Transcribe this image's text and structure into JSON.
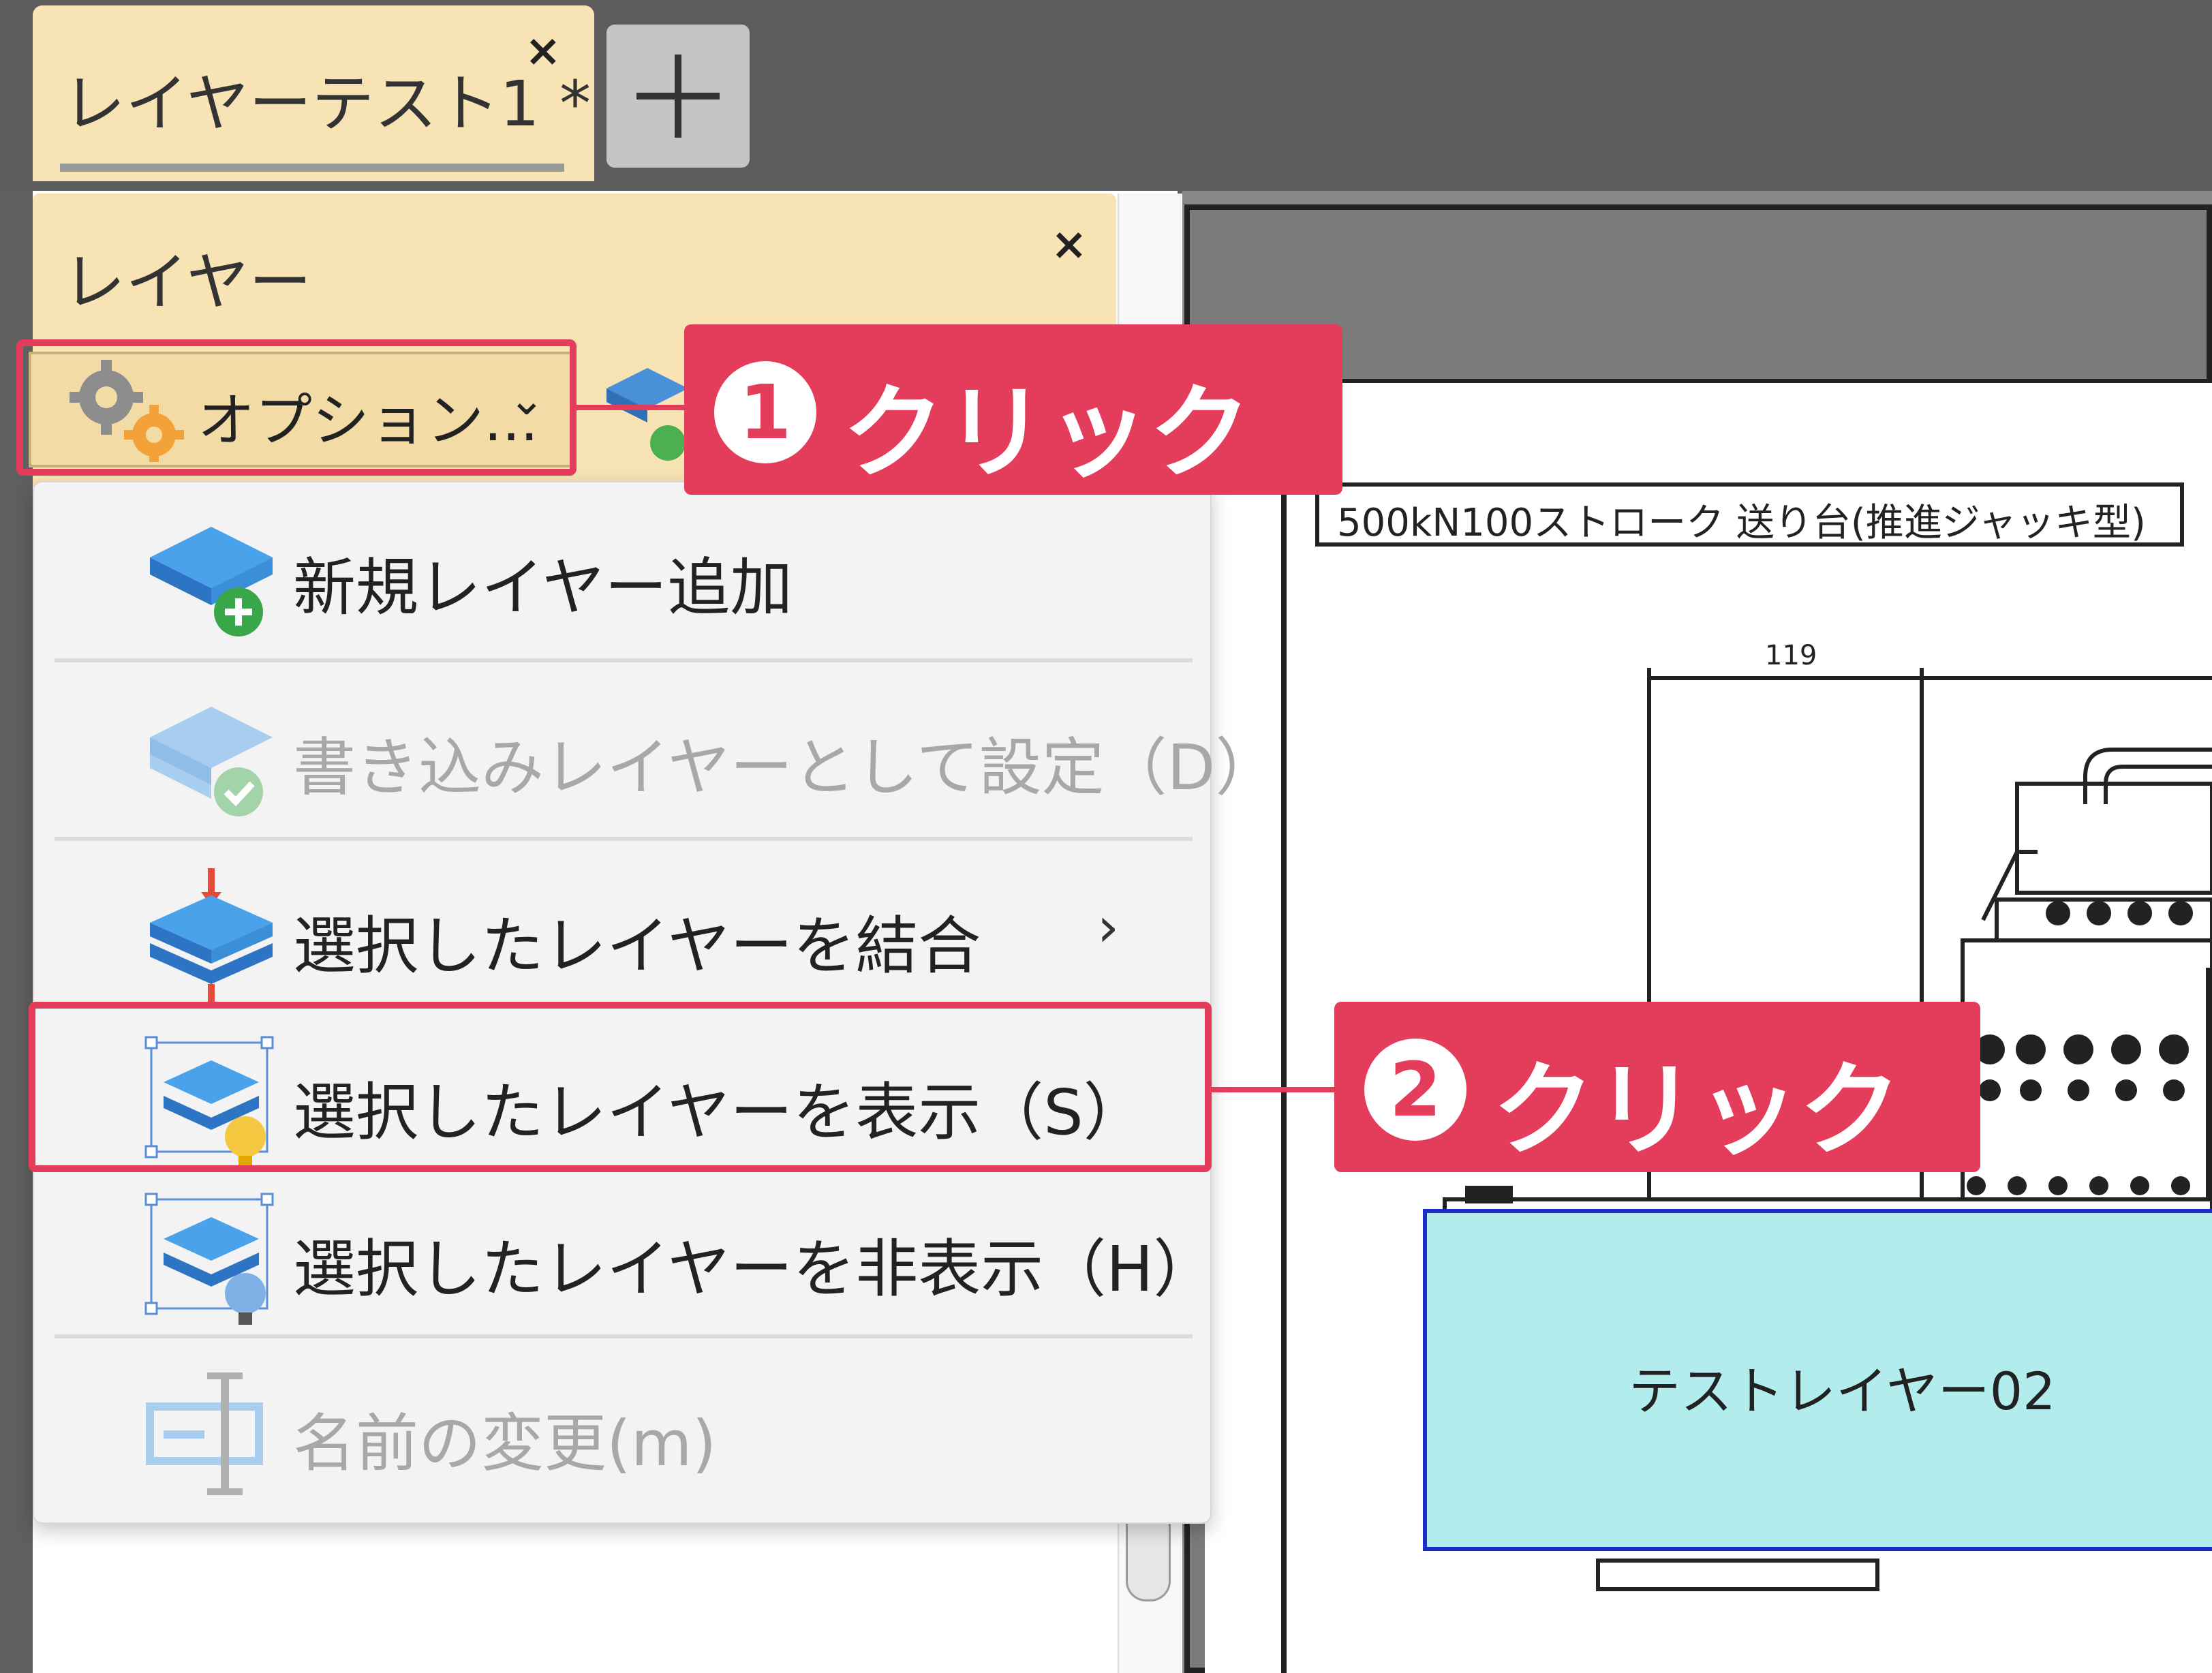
{
  "tabs": {
    "document_tab_label": "レイヤーテスト1 *",
    "close_glyph": "×",
    "new_tab_glyph": "+"
  },
  "panel": {
    "title": "レイヤー",
    "close_glyph": "×",
    "options_button_label": "オプション...",
    "options_chevron": "⌄"
  },
  "menu": {
    "items": [
      {
        "label": "新規レイヤー追加",
        "enabled": true,
        "icon": "add-layer-icon"
      },
      {
        "label": "書き込みレイヤーとして設定（D）",
        "enabled": false,
        "icon": "set-write-layer-icon"
      },
      {
        "label": "選択したレイヤーを結合",
        "enabled": true,
        "icon": "merge-layers-icon",
        "submenu_glyph": "›"
      },
      {
        "label": "選択したレイヤーを表示（S）",
        "enabled": true,
        "icon": "show-layer-icon"
      },
      {
        "label": "選択したレイヤーを非表示（H）",
        "enabled": true,
        "icon": "hide-layer-icon"
      },
      {
        "label": "名前の変更(m)",
        "enabled": false,
        "icon": "rename-icon"
      }
    ]
  },
  "drawing": {
    "title_text": "500kN100ストローク 送り台(推進ジャッキ型)",
    "dimension_label": "119",
    "test_layer_label": "テストレイヤー02"
  },
  "annotations": {
    "step1_number": "1",
    "step1_text": "クリック",
    "step2_number": "2",
    "step2_text": "クリック",
    "accent_color": "#e43d5c"
  },
  "colors": {
    "tab_background": "#f8e3b5",
    "layer_fill": "#b2ecec",
    "layer_border": "#1d2ec8"
  }
}
